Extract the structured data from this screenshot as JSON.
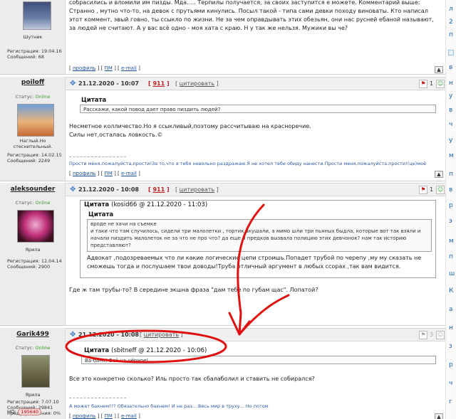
{
  "posts": [
    {
      "username": "",
      "title": "Шутник",
      "reg": "Регистрация: 19.04.16",
      "msgs": "Сообщений: 68",
      "lines": [
        "собрасились и вломили им пизды. Мда..... Терпилы получается, за своих заступится е можете. Комментарий выше:",
        "Странно , мутно что-то, на девок с прутьями кинулись. Посыл такой - типа сами девки походу виноваты. Кто написал",
        "этот коммент, эвый говно, ты ссыкло по жизни. Не за чем оправдывать этих обезьян, они нас русней ебаной называют,",
        "за людей не считают. А у вас всё одно - моя хата с краю. Н у так же нельзя. Мужики вы че?"
      ]
    },
    {
      "username": "poiloff",
      "status_label": "Статус:",
      "status": "Online",
      "title": "Наглый.Но стеснительный.",
      "reg": "Регистрация: 14.02.15",
      "msgs": "Сообщений: 2249",
      "date": "21.12.2020 - 10:07",
      "rating": "911",
      "cite": "цитировать",
      "count": "1",
      "quote_label": "Цитата",
      "quote": "Расскажи, какой повод дает право пиздить людей?",
      "lines": [
        "Несметное колличество.Но я ссыкливый,поэтому рассчитываю на красноречие.",
        "Силы нет,осталась ловкость.©"
      ],
      "signature": "Прости меня,пожалуйста,прости!За то,что я тебя невольно раздражаю.Я не хотел тебе обиду нанести.Прости меня,пожалуйста,прости!(це)моё"
    },
    {
      "username": "aleksounder",
      "status_label": "Статус:",
      "status": "Online",
      "title": "Ярила",
      "reg": "Регистрация: 12.04.14",
      "msgs": "Сообщений: 2900",
      "date": "21.12.2020 - 10:08",
      "rating": "911",
      "cite": "цитировать",
      "count": "1",
      "outer_quote_label": "Цитата",
      "outer_quote_meta": "(kosid66 @ 21.12.2020 - 11:03)",
      "inner_quote_label": "Цитата",
      "inner_quote": [
        "вроде не хачи на съемке",
        "и таки что там случилось, сидели три малолетки , тортик вкушали, а мимо шли три пьяных быдла, которые вот так взяли и",
        "начали пиздить малолеток не за что не про что? да еще и предков вызвала полицию этих девчонок? нам так историю",
        "представляют?"
      ],
      "quote_reply": [
        "Адвокат ,подозреваемых что ли какие логические цепи строишь.Попадет трубой по черепу ,му му сказать не",
        "сможешь тогда и послушаем твои доводы!Труба отличный аргумент в любых ссорах ,так вам видится."
      ],
      "lines": [
        "Где ж там трубы-то? В середине экшна фраза \"дам тебе по губам щас\". Лопатой?"
      ]
    },
    {
      "username": "Garik499",
      "status_label": "Статус:",
      "status": "Online",
      "title": "Ярила",
      "reg": "Регистрация: 7.07.10",
      "msgs": "Сообщений: 29841",
      "warn": "Предупреждения: 0%",
      "date": "21.12.2020 - 10:08",
      "cite": "цитировать",
      "count": "3",
      "quote_label": "Цитата",
      "quote_meta": "(sbitneff @ 21.12.2020 - 10:06)",
      "quote": "Ва-банк! Всё на чёрное!",
      "lines": [
        "Все это конкретно сколько? Иль просто так сбалаболил и ставить не собирался?"
      ],
      "signature": "А может бахнем!?? Обязательно бахнем! И не раз... Весь мир в труху... Но потом",
      "uq_label": "UQ:",
      "uq_value": "195640"
    }
  ],
  "links": {
    "profile": "профиль",
    "pm": "ПМ",
    "email": "e-mail"
  },
  "colors": {
    "annotation": "#e01010",
    "online": "#3a9a2a",
    "rating": "#c42020"
  }
}
